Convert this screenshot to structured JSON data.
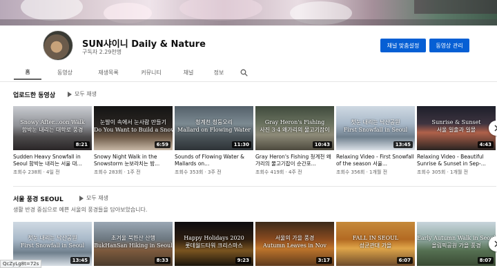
{
  "channel": {
    "name": "SUN샤이니 Daily & Nature",
    "subscribers": "구독자 2.29천명",
    "customize_button": "채널 맞춤설정",
    "manage_button": "동영상 관리"
  },
  "tabs": [
    {
      "label": "홈"
    },
    {
      "label": "동영상"
    },
    {
      "label": "재생목록"
    },
    {
      "label": "커뮤니티"
    },
    {
      "label": "채널"
    },
    {
      "label": "정보"
    }
  ],
  "uploads": {
    "title": "업로드한 동영상",
    "play_all": "모두 재생",
    "videos": [
      {
        "overlay": "Snowy After...oon Walk\n함박눈 내리는 대학로 풍경",
        "duration": "8:21",
        "title": "Sudden Heavy Snowfall in Seoul 함박눈 내리는 서울 대...",
        "meta": "조회수 238회 · 4일 전",
        "bg": "linear-gradient(180deg,#c9ccd1 0%,#8d8f94 45%,#4c4a4b 70%,#2a2627 100%)"
      },
      {
        "overlay": "눈발이 속에서 눈사람 만들기\nDo You Want to Build a Snowman?",
        "duration": "6:59",
        "title": "Snowy Night Walk in the Snowstorm 눈보라치는 밤...",
        "meta": "조회수 283회 · 1주 전",
        "bg": "linear-gradient(180deg,#141414 0%,#2b2622 45%,#6d5a48 70%,#c7b7a5 100%)"
      },
      {
        "overlay": "청계천 청둥오리\nMallard on Flowing Water",
        "duration": "11:30",
        "title": "Sounds of Flowing Water & Mallards on...",
        "meta": "조회수 353회 · 3주 전",
        "bg": "linear-gradient(180deg,#536069 0%,#7c8a92 40%,#4a5358 70%,#2e3337 100%)"
      },
      {
        "overlay": "Gray Heron's Fishing\n사진 3·4 왜가리의 물고기잡이",
        "duration": "10:43",
        "title": "Gray Heron's Fishing 청계천 왜가리의 물고기잡이 순간포...",
        "meta": "조회수 419회 · 4주 전",
        "bg": "linear-gradient(180deg,#3f4a3c 0%,#6a725f 40%,#8d8a78 65%,#4d4a3e 100%)"
      },
      {
        "overlay": "첫눈 내리는 낙산공원\nFirst Snowfall in Seoul",
        "duration": "13:45",
        "title": "Relaxing Video - First Snowfall of the season 서울...",
        "meta": "조회수 356회 · 1개월 전",
        "bg": "linear-gradient(180deg,#cfd9e3 0%,#a9b9c9 40%,#6f7f8d 70%,#d9dfe6 100%)"
      },
      {
        "overlay": "Sunrise & Sunset\n서울 일출과 일몰",
        "duration": "4:43",
        "title": "Relaxing Video - Beautiful Sunrise & Sunset in Sep-...",
        "meta": "조회수 305회 · 1개월 전",
        "bg": "linear-gradient(180deg,#1d1f2a 0%,#3e3440 40%,#b0614a 60%,#2a2422 100%)"
      }
    ]
  },
  "seoul": {
    "title": "서울 풍경 SEOUL",
    "play_all": "모두 재생",
    "description": "생활 반경 중심으로 예쁜 서울의 풍경들을 담아보았습니다.",
    "videos": [
      {
        "overlay": "첫눈 내리는 낙산공원\nFirst Snowfall in Seoul",
        "duration": "13:45",
        "bg": "linear-gradient(180deg,#cfd9e3 0%,#a9b9c9 40%,#6f7f8d 70%,#d9dfe6 100%)"
      },
      {
        "overlay": "초겨울 북한산 산행\nBukHanSan Hiking in Seoul",
        "duration": "8:33",
        "bg": "linear-gradient(180deg,#9aa7b4 0%,#6c7780 40%,#7d5a3d 65%,#4a3b2c 100%)"
      },
      {
        "overlay": "Happy Holidays 2020\n롯데월드타워 크리스마스",
        "duration": "9:23",
        "bg": "linear-gradient(180deg,#0d0c10 0%,#2c1d10 40%,#7a5420 65%,#1a140c 100%)"
      },
      {
        "overlay": "서울의 가을 풍경\nAutumn Leaves in Nov",
        "duration": "3:17",
        "bg": "linear-gradient(180deg,#3b2a1a 0%,#8a4a1f 40%,#c0762c 60%,#5e3a1c 100%)"
      },
      {
        "overlay": "FALL IN SEOUL\n성균관대 가을",
        "duration": "6:07",
        "bg": "linear-gradient(180deg,#c58a3b 0%,#b36a22 40%,#e0a64a 60%,#6d4a2a 100%)"
      },
      {
        "overlay": "Early Autumn Walk in Seoul\n올림픽공원 가을 풍경",
        "duration": "8:07",
        "bg": "linear-gradient(180deg,#c8d5dc 0%,#8fa7a0 40%,#557052 65%,#3a4a33 100%)"
      }
    ]
  },
  "status_url": "QcZyLg8t=72s"
}
